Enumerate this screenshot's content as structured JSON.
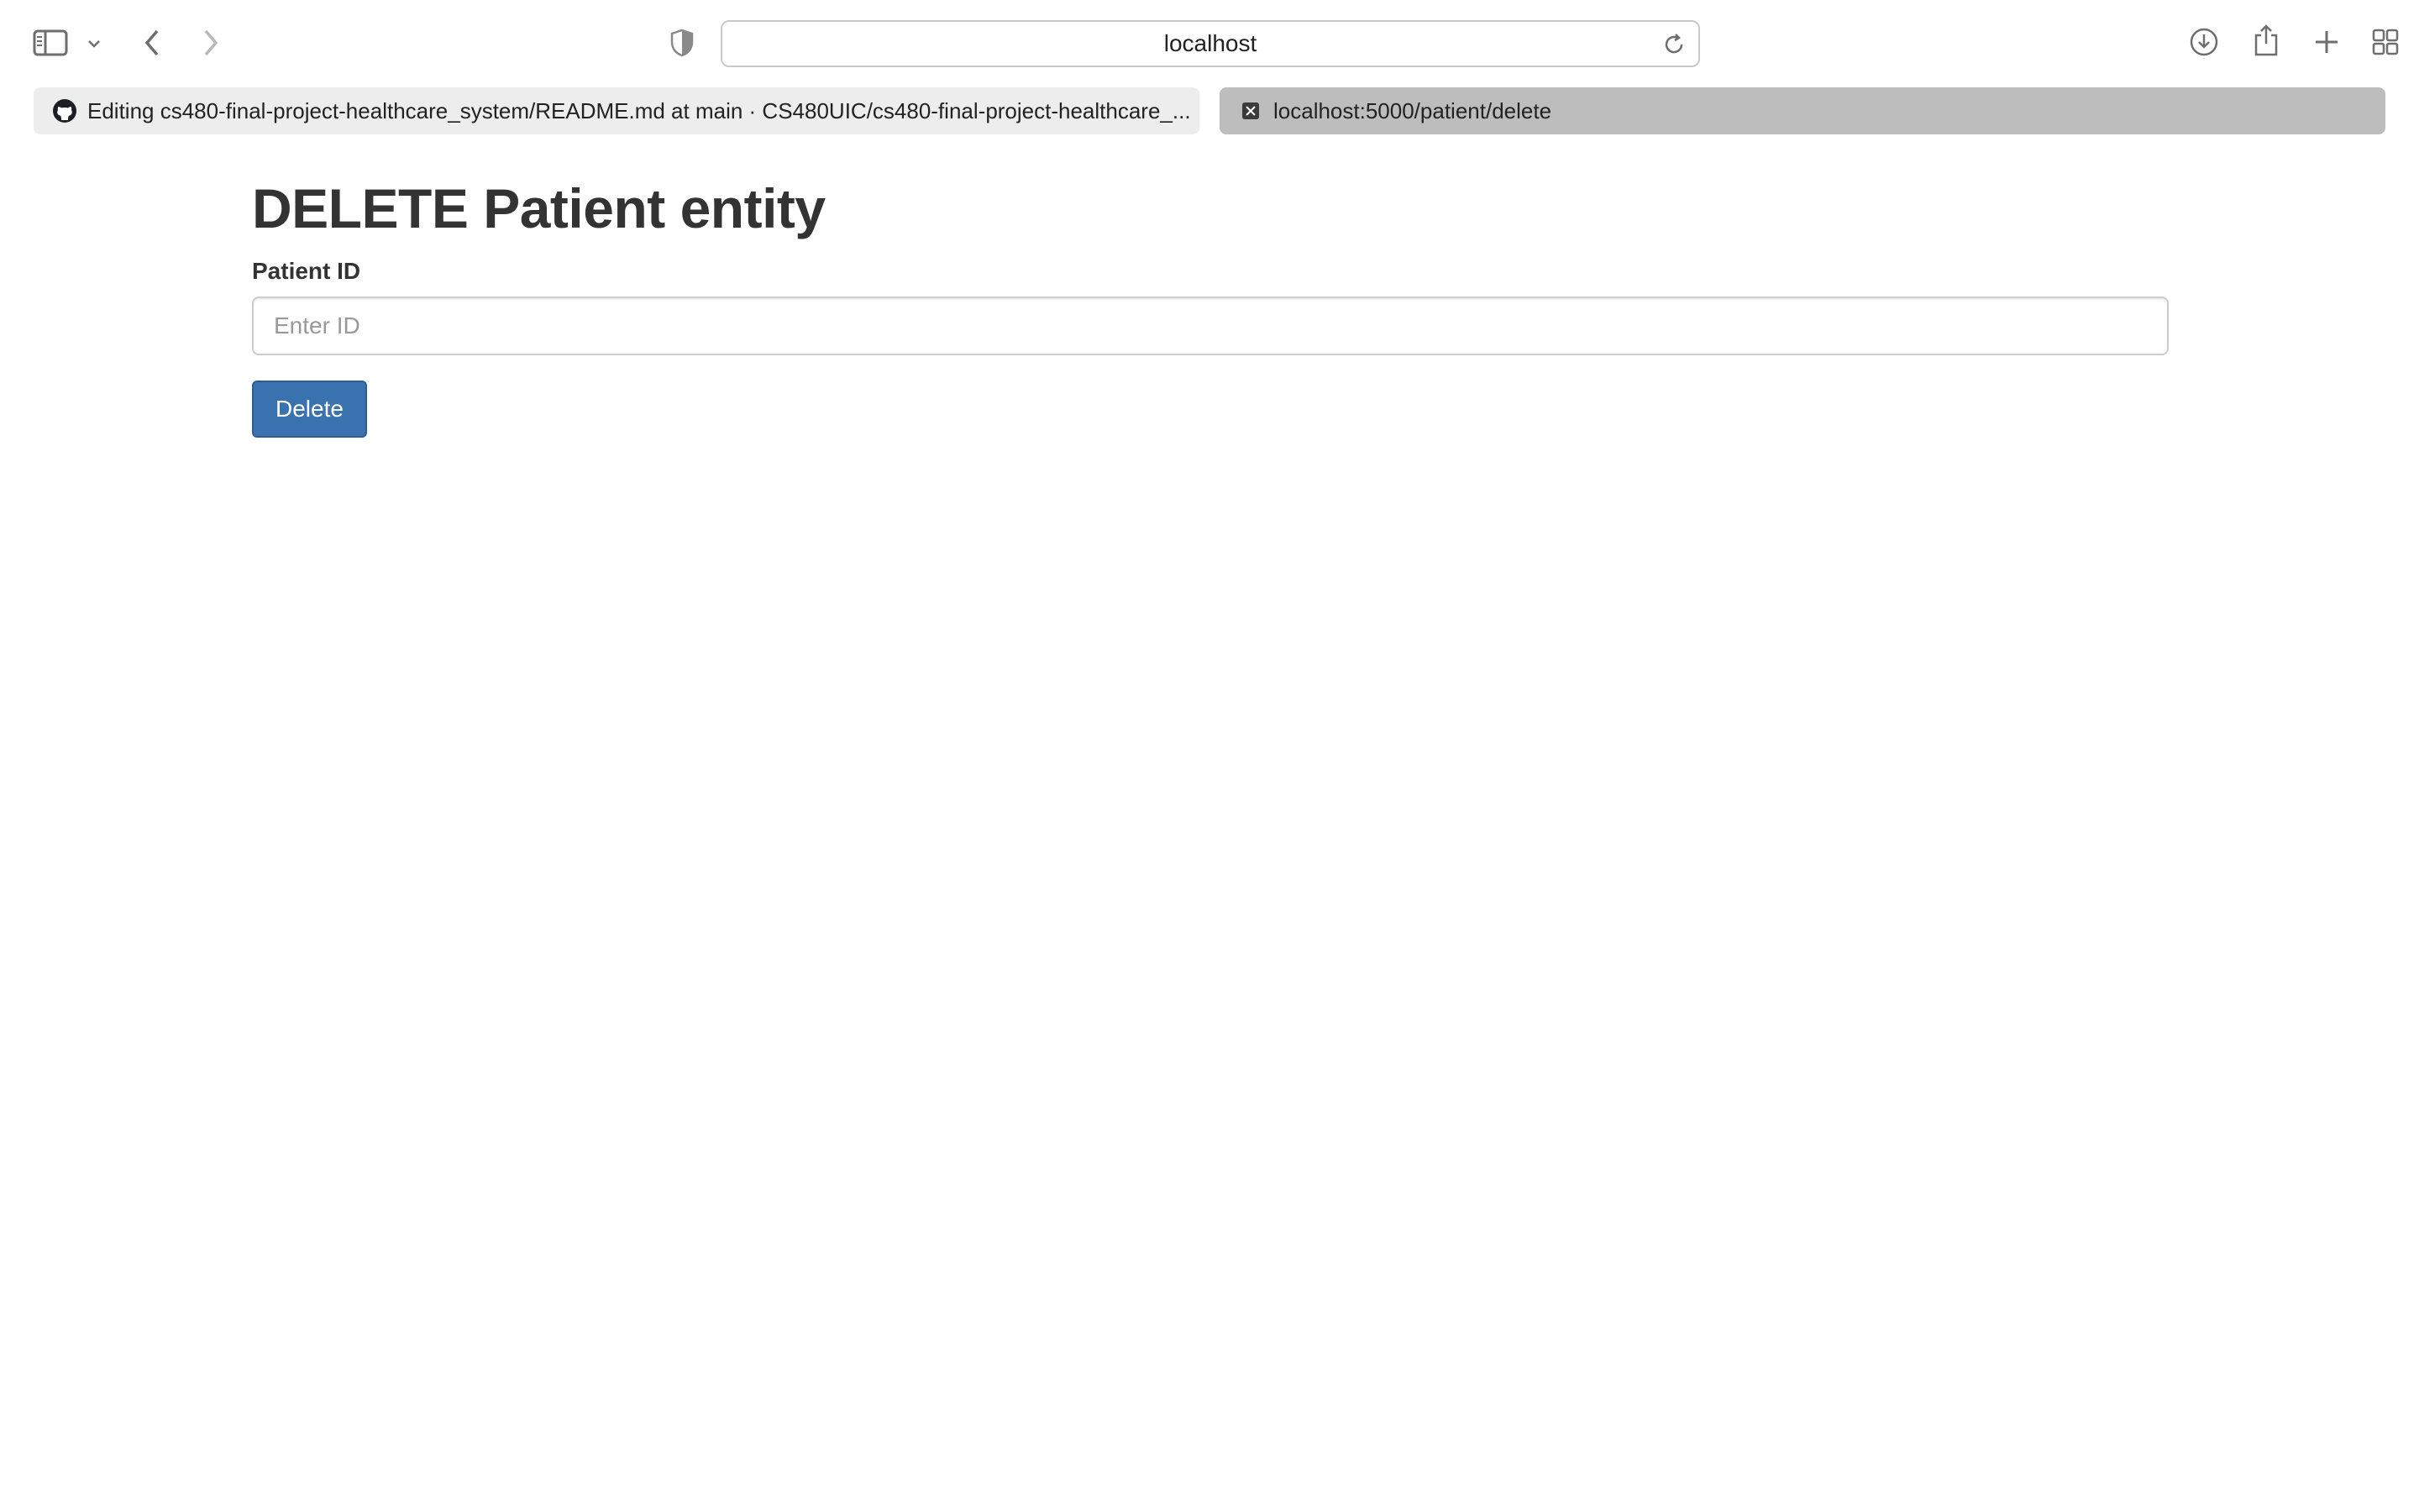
{
  "browser": {
    "address": "localhost",
    "icons": {
      "sidebar": "sidebar-icon",
      "sidebar_menu": "chevron-down-icon",
      "back": "chevron-left-icon",
      "forward": "chevron-right-icon",
      "privacy": "shield-icon",
      "reload": "reload-icon",
      "downloads": "download-icon",
      "share": "share-icon",
      "new_tab": "plus-icon",
      "tab_overview": "grid-icon"
    },
    "tabs": [
      {
        "label": "Editing cs480-final-project-healthcare_system/README.md at main · CS480UIC/cs480-final-project-healthcare_...",
        "icon": "github-icon",
        "active": false
      },
      {
        "label": "localhost:5000/patient/delete",
        "icon": "close-square-icon",
        "active": true
      }
    ]
  },
  "page": {
    "title": "DELETE Patient entity",
    "field_label": "Patient ID",
    "input_placeholder": "Enter ID",
    "input_value": "",
    "submit_label": "Delete"
  },
  "colors": {
    "button": "#3a72b0",
    "text": "#333333",
    "active_tab": "#bdbdbd",
    "inactive_tab": "#ededed"
  }
}
